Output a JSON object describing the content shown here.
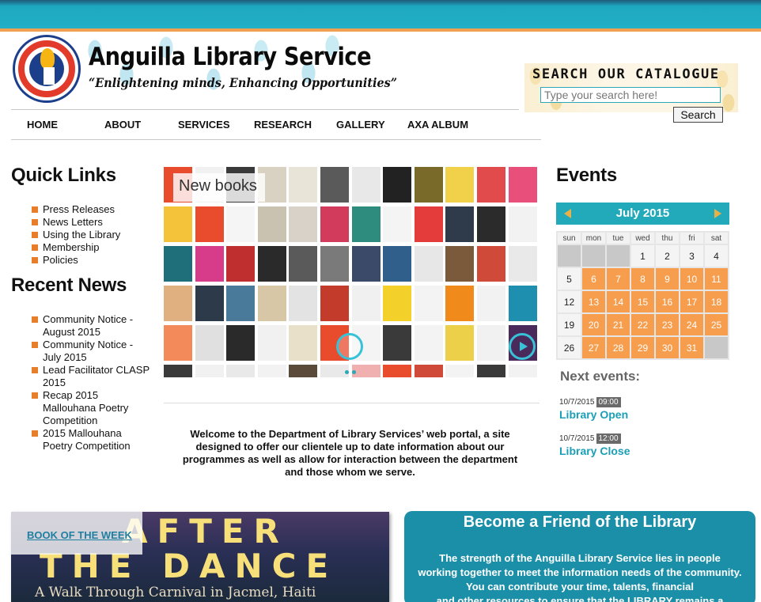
{
  "header": {
    "logo_text": "ANGUILLA LIBRARY SERVICE",
    "title": "Anguilla Library Service",
    "tagline": "“Enlightening minds, Enhancing Opportunities”"
  },
  "search": {
    "title": "SEARCH OUR CATALOGUE",
    "placeholder": "Type your search here!",
    "button_label": "Search"
  },
  "nav": {
    "items": [
      "HOME",
      "ABOUT",
      "SERVICES",
      "RESEARCH",
      "GALLERY",
      "AXA ALBUM"
    ]
  },
  "quick_links": {
    "heading": "Quick Links",
    "items": [
      "Press Releases",
      "News Letters",
      "Using the Library",
      "Membership",
      "Policies"
    ]
  },
  "recent_news": {
    "heading": "Recent News",
    "items": [
      "Community Notice - August 2015",
      "Community Notice - July 2015",
      "Lead Facilitator CLASP 2015",
      "Recap 2015 Mallouhana Poetry Competition",
      "2015 Mallouhana Poetry Competition"
    ]
  },
  "slider": {
    "caption": "New books",
    "tile_colors": [
      "#e94b2d",
      "#f1f1f1",
      "#3a3a3a",
      "#d9d2c2",
      "#e9e4d8",
      "#5a5a5a",
      "#e8e8e8",
      "#222222",
      "#7a6a2a",
      "#f1d04a",
      "#e14b4b",
      "#e84f7a",
      "#f4c33a",
      "#e94b2d",
      "#f5f5f5",
      "#c9c2b0",
      "#d8d2c8",
      "#d23b5b",
      "#2e8c7e",
      "#f4f4f4",
      "#e43b3b",
      "#2f3a4a",
      "#2b2b2b",
      "#f2f2f2",
      "#1f6f7a",
      "#d63c8a",
      "#bf2f2f",
      "#2a2a2a",
      "#5a5a5a",
      "#7a7a7a",
      "#3c4a6a",
      "#2f5f8a",
      "#e7e7e7",
      "#7a5a3a",
      "#d04a3a",
      "#e9e9e9",
      "#e0b080",
      "#2c3a4a",
      "#4a7a9a",
      "#d7c7a7",
      "#e3e3e3",
      "#c23b2b",
      "#f0f0f0",
      "#f4d02a",
      "#f3f3f3",
      "#f08a1a",
      "#f2f2f2",
      "#1f8fb0",
      "#f28a5a",
      "#e0e0e0",
      "#2a2a2a",
      "#f1f1f1",
      "#e9e0c9",
      "#e94b2d",
      "#f4f4f4",
      "#3a3a3a",
      "#f3f3f3",
      "#ecd04a",
      "#f1f1f1",
      "#4a2a5a",
      "#3a3a3a",
      "#f1f1f1",
      "#e9e9e9",
      "#f2f2f2",
      "#5a4a3a",
      "#e9e9e9",
      "#f0b0b0",
      "#e94b2d",
      "#d04a3a",
      "#f3f3f3",
      "#3a3a3a",
      "#f2f2f2"
    ]
  },
  "welcome": {
    "text": "Welcome to the Department of Library Services’ web portal, a site designed to offer our clientele up to date information about our programmes as well as allow for interaction between the department and those whom we serve."
  },
  "events": {
    "heading": "Events",
    "month_label": "July 2015",
    "weekdays": [
      "sun",
      "mon",
      "tue",
      "wed",
      "thu",
      "fri",
      "sat"
    ],
    "weeks": [
      [
        null,
        null,
        null,
        "1",
        "2",
        "3",
        "4"
      ],
      [
        "5",
        "6",
        "7",
        "8",
        "9",
        "10",
        "11"
      ],
      [
        "12",
        "13",
        "14",
        "15",
        "16",
        "17",
        "18"
      ],
      [
        "19",
        "20",
        "21",
        "22",
        "23",
        "24",
        "25"
      ],
      [
        "26",
        "27",
        "28",
        "29",
        "30",
        "31",
        null
      ]
    ],
    "next_heading": "Next events:",
    "list": [
      {
        "date": "10/7/2015",
        "time": "09:00",
        "title": "Library Open"
      },
      {
        "date": "10/7/2015",
        "time": "12:00",
        "title": "Library Close"
      }
    ]
  },
  "book_of_week": {
    "label": "BOOK OF THE WEEK",
    "cover_line1": "AFTER",
    "cover_line2": "THE DANCE",
    "cover_sub": "A Walk Through Carnival in Jacmel, Haiti"
  },
  "friend": {
    "title": "Become a Friend of the Library",
    "body_lines": [
      "The strength of the Anguilla Library Service lies in people",
      "working together to meet the information needs of the community.",
      "You can contribute your time, talents, financial",
      "and other resources to ensure that the LIBRARY remains a"
    ]
  },
  "colors": {
    "accent_teal": "#22aabb",
    "accent_orange": "#f79d4e",
    "link_blue": "#1b9fb6"
  }
}
